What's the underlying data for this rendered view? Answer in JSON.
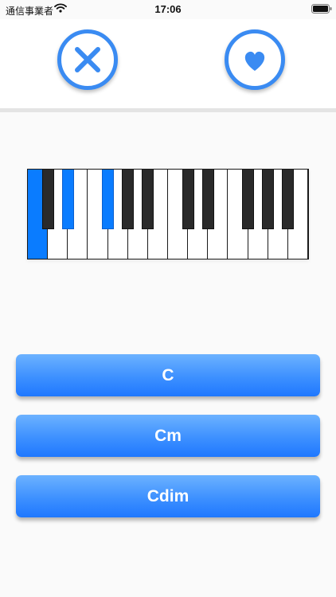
{
  "status_bar": {
    "carrier": "通信事業者",
    "time": "17:06"
  },
  "header": {
    "dismiss_icon": "close-x-icon",
    "favorite_icon": "heart-icon",
    "accent_color": "#3a8bf2"
  },
  "piano": {
    "white_keys_count": 14,
    "pressed_white_keys": [
      0
    ],
    "pressed_black_keys": [
      1,
      2
    ],
    "pressed_color": "#0a7cff"
  },
  "answers": [
    {
      "label": "C"
    },
    {
      "label": "Cm"
    },
    {
      "label": "Cdim"
    }
  ]
}
